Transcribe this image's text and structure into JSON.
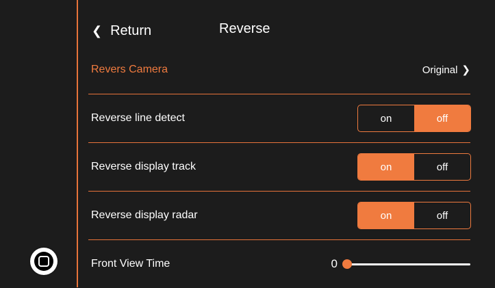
{
  "header": {
    "return_label": "Return",
    "title": "Reverse"
  },
  "camera_row": {
    "label": "Revers Camera",
    "value": "Original"
  },
  "rows": [
    {
      "label": "Reverse line detect",
      "on_label": "on",
      "off_label": "off",
      "selected": "off"
    },
    {
      "label": "Reverse display track",
      "on_label": "on",
      "off_label": "off",
      "selected": "on"
    },
    {
      "label": "Reverse display radar",
      "on_label": "on",
      "off_label": "off",
      "selected": "on"
    }
  ],
  "front_view": {
    "label": "Front View Time",
    "value": "0",
    "fraction": 0
  },
  "colors": {
    "accent": "#f07b3f",
    "background": "#1c1c1c"
  }
}
